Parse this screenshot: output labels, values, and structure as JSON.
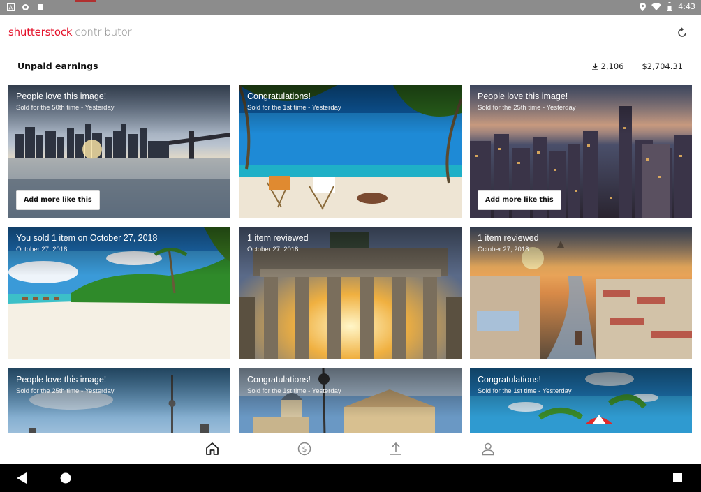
{
  "status_bar": {
    "time": "4:43",
    "icons": [
      "a-icon",
      "sync-icon",
      "sd-card-icon",
      "location-icon",
      "wifi-icon",
      "battery-icon"
    ]
  },
  "app_bar": {
    "brand": "shutterstock",
    "suffix": "contributor",
    "refresh_icon": "refresh-icon"
  },
  "earnings": {
    "title": "Unpaid earnings",
    "downloads": "2,106",
    "amount": "$2,704.31"
  },
  "cards": [
    {
      "title": "People love this image!",
      "subtitle": "Sold for the 50th time - Yesterday",
      "button": "Add more like this",
      "scene": "city-waterfront"
    },
    {
      "title": "Congratulations!",
      "subtitle": "Sold for the 1st time - Yesterday",
      "button": "",
      "scene": "beach-chairs"
    },
    {
      "title": "People love this image!",
      "subtitle": "Sold for the 25th time - Yesterday",
      "button": "Add more like this",
      "scene": "city-night"
    },
    {
      "title": "You sold 1 item on October 27, 2018",
      "subtitle": "October 27, 2018",
      "button": "",
      "scene": "tropical-beach"
    },
    {
      "title": "1 item reviewed",
      "subtitle": "October 27, 2018",
      "button": "",
      "scene": "brandenburg-gate"
    },
    {
      "title": "1 item reviewed",
      "subtitle": "October 27, 2018",
      "button": "",
      "scene": "river-city"
    },
    {
      "title": "People love this image!",
      "subtitle": "Sold for the 25th time - Yesterday",
      "button": "",
      "scene": "tv-tower"
    },
    {
      "title": "Congratulations!",
      "subtitle": "Sold for the 1st time - Yesterday",
      "button": "",
      "scene": "square-buildings"
    },
    {
      "title": "Congratulations!",
      "subtitle": "Sold for the 1st time - Yesterday",
      "button": "",
      "scene": "palm-umbrella"
    }
  ],
  "bottom_nav": [
    {
      "icon": "home-icon",
      "active": true
    },
    {
      "icon": "dollar-icon",
      "active": false
    },
    {
      "icon": "upload-icon",
      "active": false
    },
    {
      "icon": "profile-icon",
      "active": false
    }
  ],
  "system_nav": [
    "back-icon",
    "home-circle-icon",
    "recents-icon"
  ]
}
